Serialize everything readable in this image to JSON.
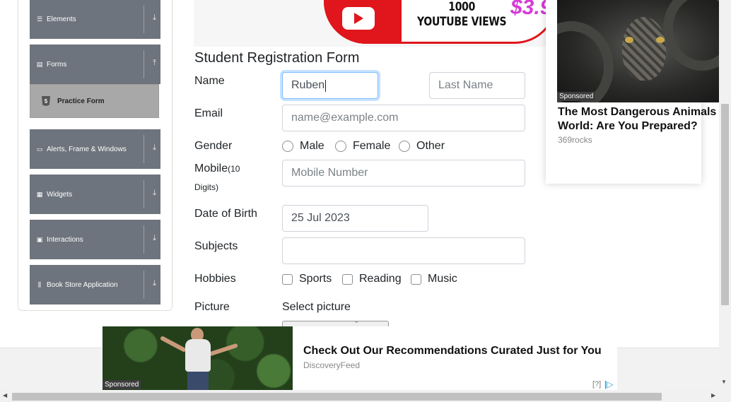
{
  "sidebar": {
    "groups": [
      {
        "label": "Elements",
        "icon": "list-icon",
        "arrow": "⤓"
      },
      {
        "label": "Forms",
        "icon": "form-icon",
        "arrow": "⤒"
      },
      {
        "label": "Alerts, Frame & Windows",
        "icon": "window-icon",
        "arrow": "⤓"
      },
      {
        "label": "Widgets",
        "icon": "widgets-icon",
        "arrow": "⤓"
      },
      {
        "label": "Interactions",
        "icon": "interactions-icon",
        "arrow": "⤓"
      },
      {
        "label": "Book Store Application",
        "icon": "bookstore-icon",
        "arrow": "⤓"
      }
    ],
    "active_item": {
      "label": "Practice Form",
      "icon": "html5-icon",
      "icon_glyph": "5"
    }
  },
  "top_banner": {
    "line1": "1000",
    "line2": "YOUTUBE VIEWS",
    "price": "$3.9"
  },
  "form": {
    "title": "Student Registration Form",
    "name_label": "Name",
    "first_name_value": "Ruben",
    "last_name_placeholder": "Last Name",
    "email_label": "Email",
    "email_placeholder": "name@example.com",
    "gender_label": "Gender",
    "gender_options": [
      "Male",
      "Female",
      "Other"
    ],
    "mobile_label": "Mobile",
    "mobile_hint": "(10",
    "mobile_hint2": "Digits)",
    "mobile_placeholder": "Mobile Number",
    "dob_label": "Date of Birth",
    "dob_value": "25 Jul 2023",
    "subjects_label": "Subjects",
    "hobbies_label": "Hobbies",
    "hobby_options": [
      "Sports",
      "Reading",
      "Music"
    ],
    "picture_label": "Picture",
    "select_picture": "Select picture"
  },
  "side_ad": {
    "sponsored": "Sponsored",
    "headline": "The Most Dangerous Animals World: Are You Prepared?",
    "source": "369rocks"
  },
  "bottom_ad": {
    "sponsored": "Sponsored",
    "headline": "Check Out Our Recommendations Curated Just for You",
    "source": "DiscoveryFeed",
    "info": "[?]"
  },
  "colors": {
    "sidebar_group_bg": "#6d747d",
    "active_item_bg": "#a8a8a8",
    "focus_border": "#80bdff",
    "youtube_red": "#e0161c"
  }
}
